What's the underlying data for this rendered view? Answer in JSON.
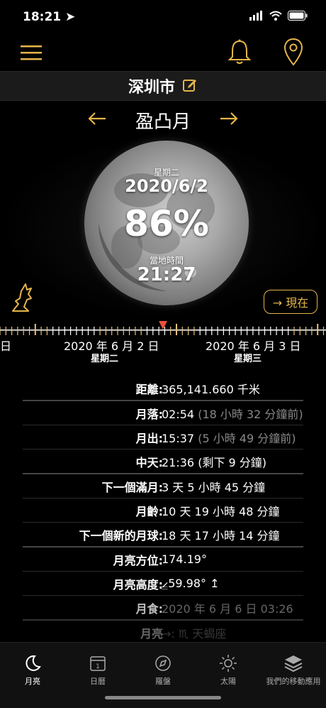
{
  "status": {
    "time": "18:21"
  },
  "header": {
    "city": "深圳市"
  },
  "phase": {
    "name": "盈凸月"
  },
  "moon": {
    "weekday": "星期二",
    "date": "2020/6/2",
    "illumination": "86%",
    "local_time_label": "當地時間",
    "local_time": "21:27"
  },
  "now_button": "→ 現在",
  "timeline": {
    "left_edge": "日",
    "date1": "2020 年 6 月 2 日",
    "day1": "星期二",
    "date2": "2020 年 6 月 3 日",
    "day2": "星期三"
  },
  "info": [
    {
      "label": "距離:",
      "value": "365,141.660 千米",
      "sub": ""
    },
    {
      "label": "月落:",
      "value": "02:54 ",
      "sub": "(18 小時 32 分鐘前)"
    },
    {
      "label": "月出:",
      "value": "15:37 ",
      "sub": "(5 小時 49 分鐘前)"
    },
    {
      "label": "中天:",
      "value": "21:36 (剩下 9 分鐘)",
      "sub": ""
    },
    {
      "label": "下一個滿月:",
      "value": "3 天 5 小時 45 分鐘",
      "sub": ""
    },
    {
      "label": "月齡:",
      "value": "10 天 19 小時 48 分鐘",
      "sub": ""
    },
    {
      "label": "下一個新的月球:",
      "value": "18 天 17 小時 14 分鐘",
      "sub": ""
    },
    {
      "label": "月亮方位:",
      "value": "174.19°",
      "sub": ""
    },
    {
      "label": "月亮高度:",
      "value": "⦤59.98° ↥",
      "sub": ""
    },
    {
      "label": "月食:",
      "value": "",
      "sub": "2020 年 6 月 6 日 03:26"
    },
    {
      "label": "月亮",
      "value": "",
      "sub": "→: ♏ 天蝎座"
    }
  ],
  "tabs": [
    {
      "label": "月亮"
    },
    {
      "label": "日曆"
    },
    {
      "label": "羅盤"
    },
    {
      "label": "太陽"
    },
    {
      "label": "我們的移動應用"
    }
  ],
  "calendar_icon_day": "1",
  "colors": {
    "accent": "#e5b54a"
  }
}
